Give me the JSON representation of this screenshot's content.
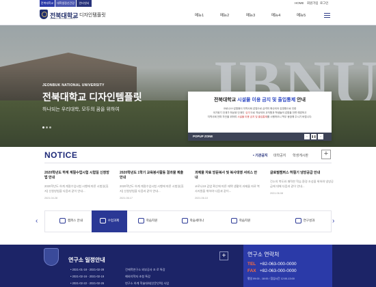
{
  "util": {
    "tabs": [
      {
        "label": "전북대학교",
        "color": "#2b3aa8"
      },
      {
        "label": "대학생정신건강",
        "color": "#4a56b0"
      },
      {
        "label": "인터넷서",
        "color": "#27327a"
      }
    ],
    "links": [
      "HOME",
      "회원가입",
      "로그인"
    ]
  },
  "header": {
    "logo_text": "전북대학교",
    "logo_sub": "JEONBUK NATIONAL UNIVERSITY",
    "site_name": "디자인템플릿",
    "menus": [
      "메뉴1",
      "메뉴2",
      "메뉴3",
      "메뉴4",
      "메뉴5"
    ]
  },
  "hero": {
    "eng": "JEONBUK NATIONAL UNIVERSITY",
    "title": "전북대학교 디자인템플릿",
    "subtitle": "하나되는 우리대학, 모두의 꿈을 위하여",
    "bg_text": "JBNU",
    "dots": 3,
    "active_dot": 0
  },
  "popup": {
    "title_pre": "전북대학교 ",
    "title_highlight": "시설물 이용 금지 및 출입통제",
    "title_post": " 안내",
    "body1": "코로나19 감염증이 지역사회 감염으로 급격히 확산되어 감염병으로 인한",
    "body2_pre": "국가위기 단계가 최상위 단계인 ",
    "body2_red": "'심각'",
    "body2_post": "으로 격상되어 교직원과 학생들의 감염을 전면 예방하고",
    "body3_pre": "지역사회 전파 차단을 위하여 ",
    "body3_red": "시설물 이용 금지 및 출입통제",
    "body3_post": "를 시행하오니 학우 동참해 주시기 바랍니다.",
    "zone_label": "POPUP ZONE",
    "controls": [
      "‹",
      "❚❚",
      "›"
    ]
  },
  "notice": {
    "title": "NOTICE",
    "tabs": [
      "• 기관공지",
      "대학공지",
      "학생게시판"
    ],
    "active_tab": 0,
    "plus": "+",
    "items": [
      {
        "title": "2020학년도 하계 계절수업시험 시험일 신청방법 안내",
        "body": "2020학년도 하계 계절수업시험 시행에 따른 시험일(휴지) 신청방법을 다음과 같이 안내...",
        "date": "2021.04.28"
      },
      {
        "title": "2020학년도 1학기 교육봉사활동 결과물 제출 안내",
        "body": "2020학년도 하계 계절수업시험 시행에 따른 시험일(휴지) 신청방법을 다음과 같이 안내...",
        "date": "2021.06.17"
      },
      {
        "title": "과제물 자료 방문복사 및 복사대행 서비스 안내",
        "body": "코로나19 감염 확산에 따른 재택 생활의 과제물 자료 복사지원을 위하여 다음과 같이...",
        "date": "2021.06.10"
      },
      {
        "title": "글로벌캠퍼스 하절기 냉방공급 안내",
        "body": "건소의 복도와 쾌적한 학습 환경 조성을 위하여 냉방공급에 대해 다음과 같이 안내...",
        "date": "2021.06.08"
      }
    ]
  },
  "quick": {
    "prev": "‹",
    "next": "›",
    "items": [
      "캠퍼스 안내",
      "수업과제",
      "학습지원",
      "학습세미나",
      "학습지원",
      "연구성과"
    ],
    "active": 1
  },
  "schedule": {
    "title": "연구소 일정안내",
    "plus": "+",
    "rows": [
      {
        "range": "• 2021-01-18 - 2021-02-28",
        "text": "건에학연구소 외부공사 조 로 특강"
      },
      {
        "range": "• 2021-02-16 - 2021-02-19",
        "text": "해외석학자 초청 특강"
      },
      {
        "range": "• 2021-02-22 - 2021-02-26",
        "text": "연구소 하계 학술대회(인문인력) 사업"
      }
    ]
  },
  "contact": {
    "title": "연구소 연락처",
    "tel_label": "TEL",
    "tel": "+82-063-000-0000",
    "fax_label": "FAX",
    "fax": "+82-063-000-0000",
    "hours": "평일 09:00 - 18:00 / 점심시간 12:00-13:00"
  },
  "colors": {
    "primary": "#1e2a78",
    "accent": "#2b46c2",
    "footer": "#1c2467",
    "highlight": "#ff6c3a"
  }
}
